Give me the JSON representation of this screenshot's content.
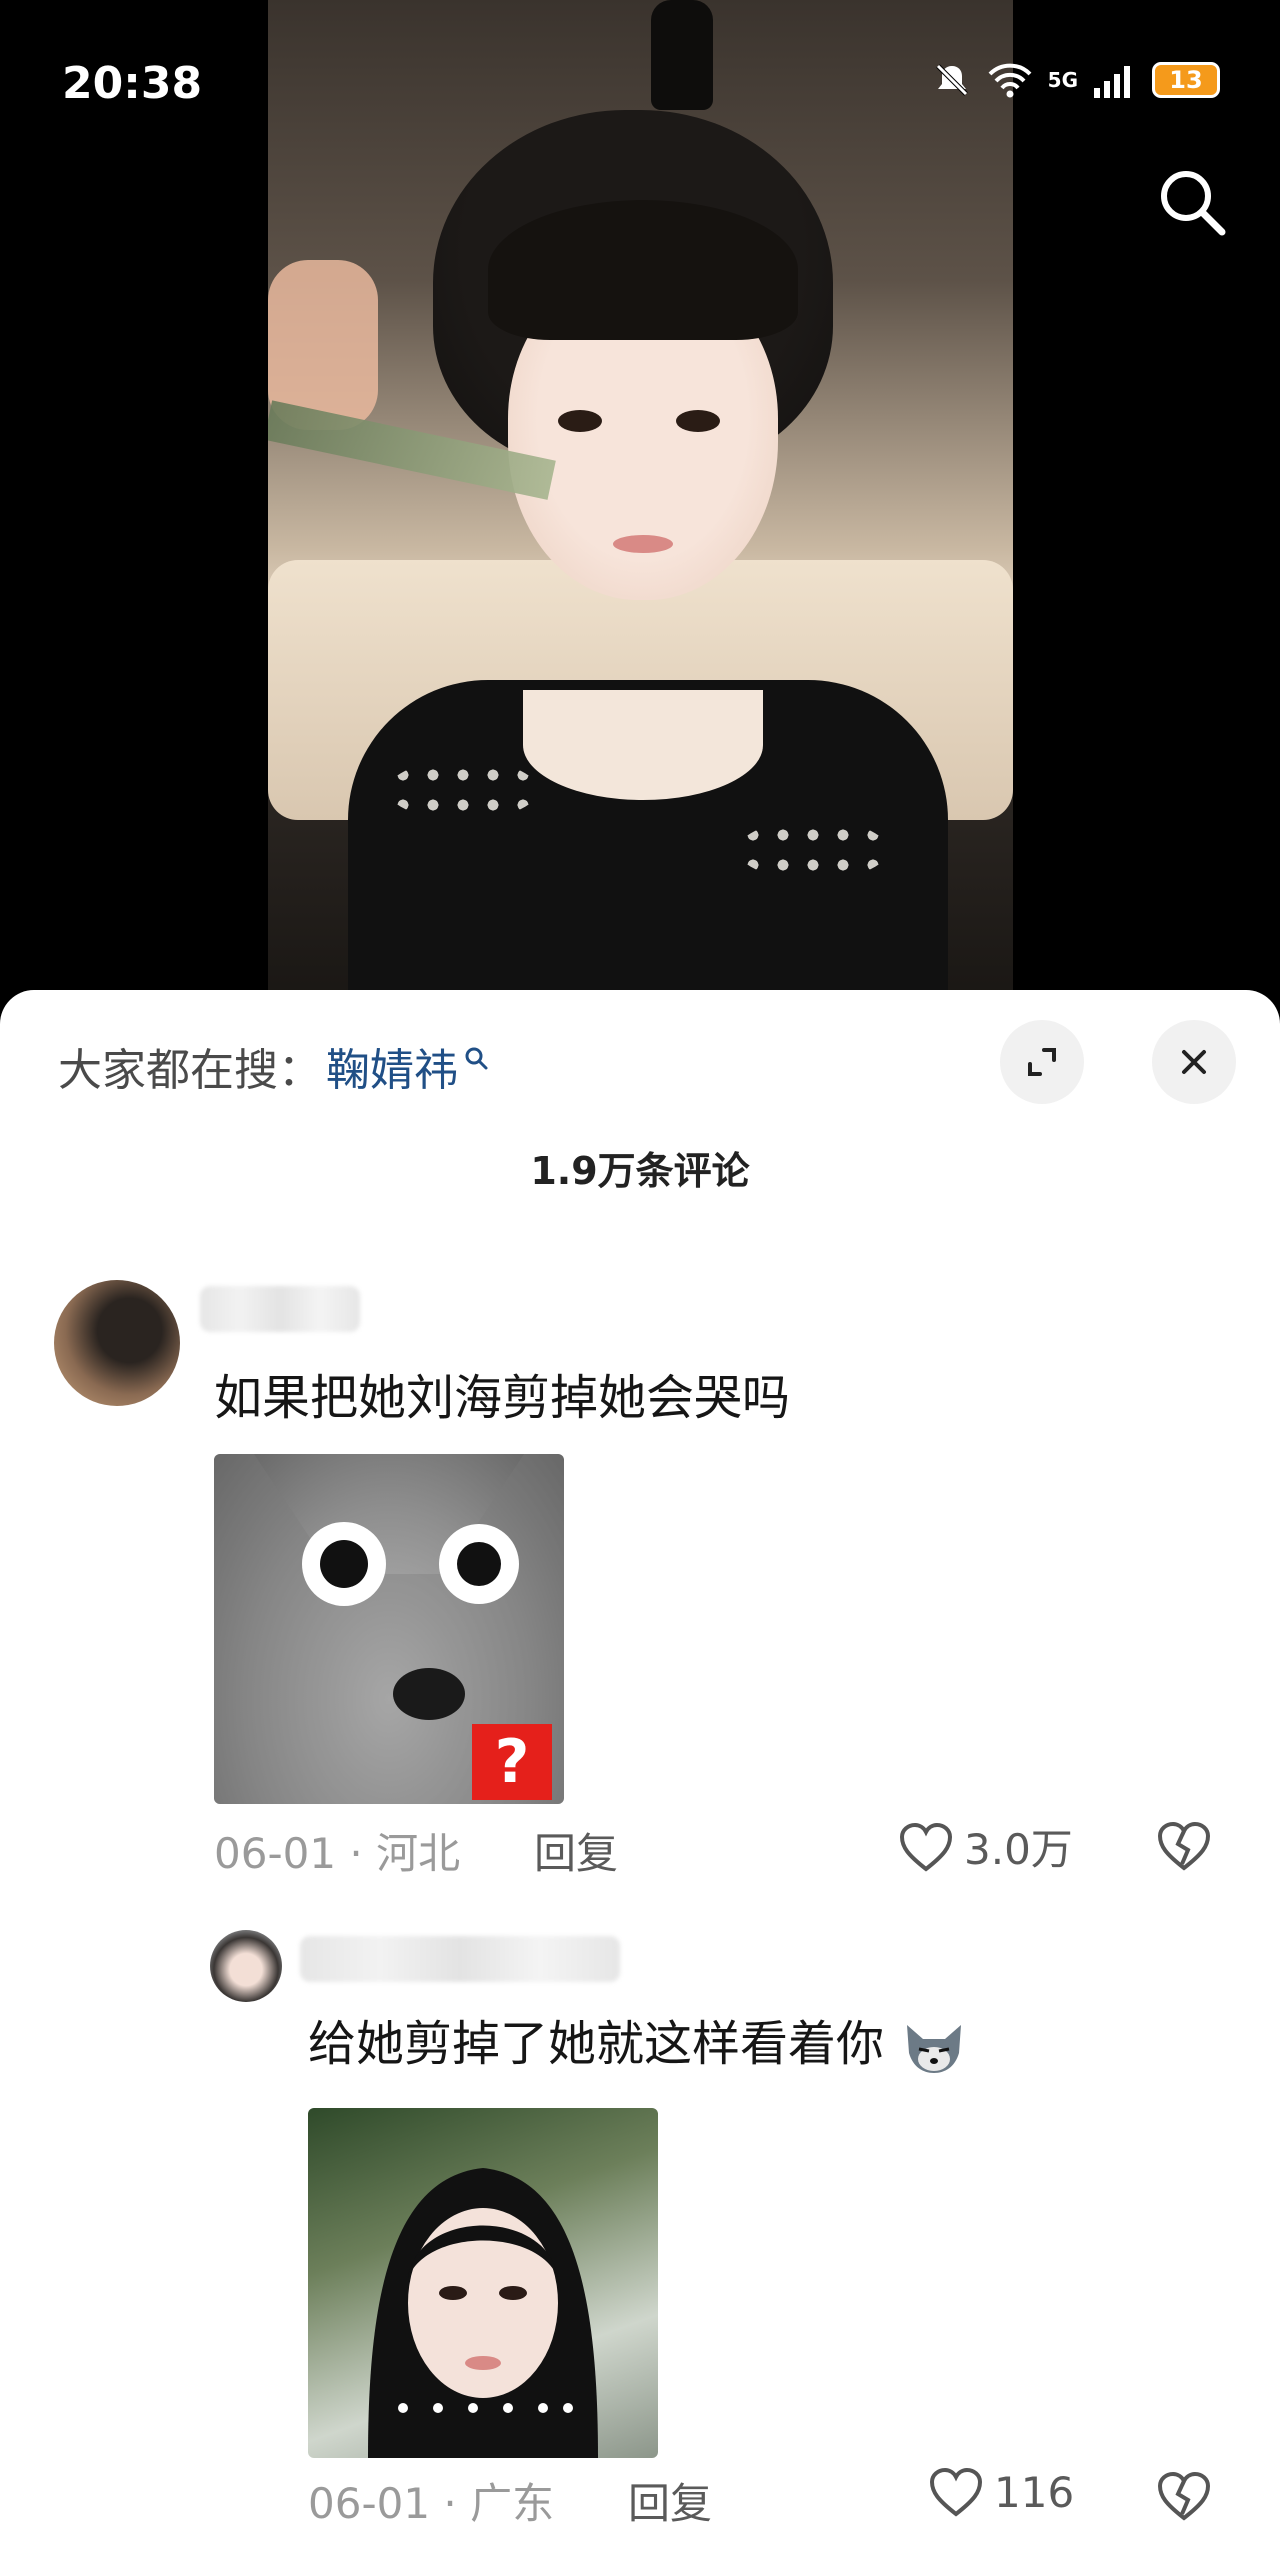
{
  "status_bar": {
    "time": "20:38",
    "battery": "13",
    "network": "5G"
  },
  "search_hint": {
    "prefix": "大家都在搜：",
    "keyword": "鞠婧祎"
  },
  "comments_header": {
    "count_label": "1.9万条评论"
  },
  "comments": [
    {
      "text": "如果把她刘海剪掉她会哭吗",
      "date": "06-01",
      "location": "河北",
      "reply_label": "回复",
      "likes": "3.0万",
      "image_badge": "?"
    },
    {
      "text": "给她剪掉了她就这样看着你",
      "date": "06-01",
      "location": "广东",
      "reply_label": "回复",
      "likes": "116"
    }
  ],
  "colors": {
    "keyword": "#204f86",
    "badge": "#e5201b",
    "battery": "#f59a1b"
  }
}
